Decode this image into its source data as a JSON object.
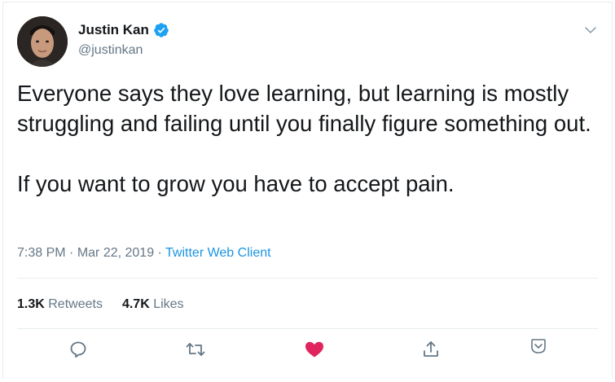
{
  "author": {
    "display_name": "Justin Kan",
    "handle": "@justinkan",
    "verified": true
  },
  "tweet": {
    "text": "Everyone says they love learning, but learning is mostly struggling and failing until you finally figure something out.\n\nIf you want to grow you have to accept pain.",
    "time": "7:38 PM",
    "date": "Mar 22, 2019",
    "separator": " · ",
    "client": "Twitter Web Client"
  },
  "stats": {
    "retweets_count": "1.3K",
    "retweets_label": "Retweets",
    "likes_count": "4.7K",
    "likes_label": "Likes"
  },
  "actions": [
    {
      "name": "reply",
      "icon": "reply-icon"
    },
    {
      "name": "retweet",
      "icon": "retweet-icon"
    },
    {
      "name": "like",
      "icon": "heart-icon",
      "active": true
    },
    {
      "name": "share",
      "icon": "share-icon"
    },
    {
      "name": "more",
      "icon": "chevron-down-box-icon"
    }
  ],
  "colors": {
    "text": "#14171a",
    "secondary": "#657786",
    "link": "#1b95e0",
    "verified": "#1da1f2",
    "like": "#e0245e",
    "border": "#e6ecf0"
  }
}
